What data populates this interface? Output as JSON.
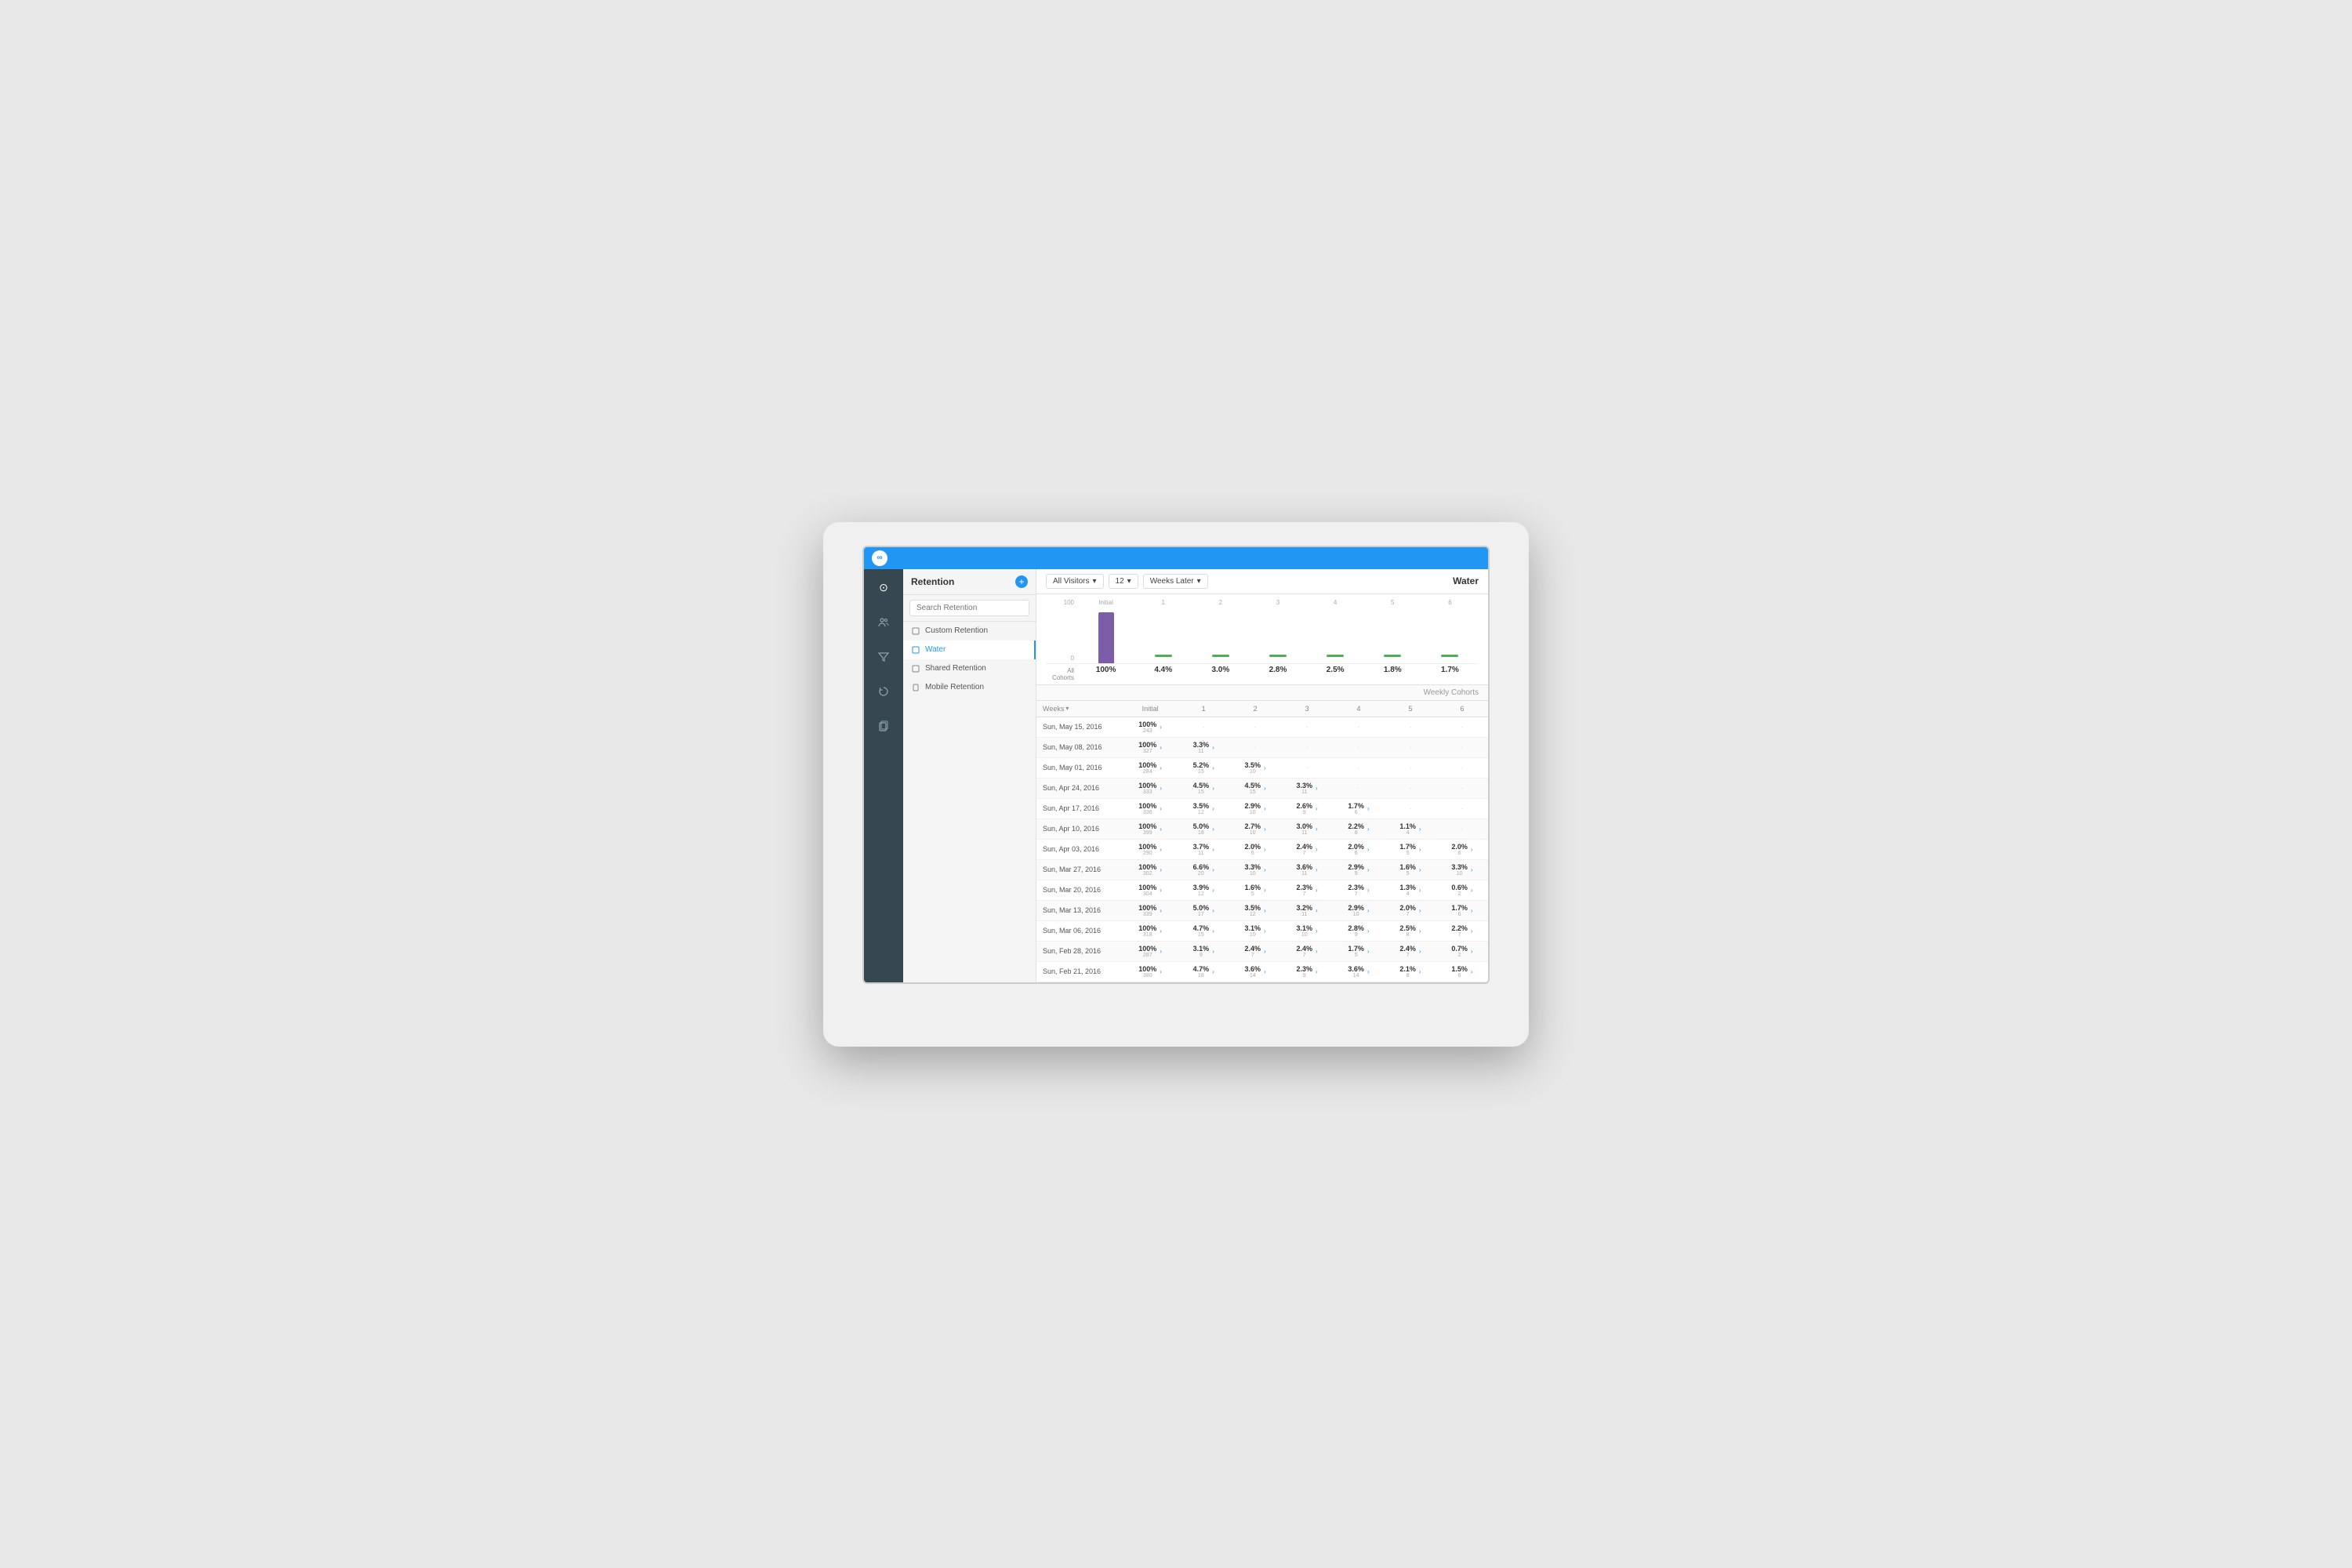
{
  "titleBar": {
    "appIcon": "∞"
  },
  "sidebar": {
    "icons": [
      {
        "name": "clock-icon",
        "symbol": "⊙",
        "active": true
      },
      {
        "name": "users-icon",
        "symbol": "👥",
        "active": false
      },
      {
        "name": "funnel-icon",
        "symbol": "⬡",
        "active": false
      },
      {
        "name": "refresh-icon",
        "symbol": "↺",
        "active": false
      },
      {
        "name": "pages-icon",
        "symbol": "⬜",
        "active": false
      }
    ]
  },
  "leftPanel": {
    "title": "Retention",
    "addBtn": "+",
    "search": {
      "placeholder": "Search Retention"
    },
    "items": [
      {
        "label": "Custom Retention",
        "icon": "□",
        "active": false
      },
      {
        "label": "Water",
        "icon": "□",
        "active": true
      },
      {
        "label": "Shared Retention",
        "icon": "□",
        "active": false
      },
      {
        "label": "Mobile Retention",
        "icon": "□",
        "active": false
      }
    ]
  },
  "toolbar": {
    "allVisitors": "All Visitors",
    "weeks": "12",
    "weeksLater": "Weeks Later",
    "reportTitle": "Water"
  },
  "chart": {
    "yLabels": [
      "100",
      "0"
    ],
    "allCohortsLabel": "All Cohorts",
    "columns": [
      {
        "header": "Initial",
        "type": "bar",
        "value": "100%"
      },
      {
        "header": "1",
        "type": "line",
        "value": "4.4%"
      },
      {
        "header": "2",
        "type": "line",
        "value": "3.0%"
      },
      {
        "header": "3",
        "type": "line",
        "value": "2.8%"
      },
      {
        "header": "4",
        "type": "line",
        "value": "2.5%"
      },
      {
        "header": "5",
        "type": "line",
        "value": "1.8%"
      },
      {
        "header": "6",
        "type": "line",
        "value": "1.7%"
      }
    ]
  },
  "table": {
    "weeklyCohorts": "Weekly Cohorts",
    "headers": [
      "Weeks",
      "Initial",
      "1",
      "2",
      "3",
      "4",
      "5",
      "6"
    ],
    "rows": [
      {
        "date": "Sun, May 15, 2016",
        "cells": [
          {
            "pct": "100%",
            "count": "243",
            "arrow": true
          },
          {
            "pct": "",
            "count": "",
            "dot": true
          },
          {
            "pct": "",
            "count": "",
            "dot": true
          },
          {
            "pct": "",
            "count": "",
            "dot": true
          },
          {
            "pct": "",
            "count": "",
            "dot": true
          },
          {
            "pct": "",
            "count": "",
            "dot": true
          },
          {
            "pct": "",
            "count": "",
            "dot": true
          }
        ]
      },
      {
        "date": "Sun, May 08, 2016",
        "cells": [
          {
            "pct": "100%",
            "count": "327",
            "arrow": true
          },
          {
            "pct": "3.3%",
            "count": "11",
            "arrow": true
          },
          {
            "pct": "",
            "count": "",
            "dot": true
          },
          {
            "pct": "",
            "count": "",
            "dot": true
          },
          {
            "pct": "",
            "count": "",
            "dot": true
          },
          {
            "pct": "",
            "count": "",
            "dot": true
          },
          {
            "pct": "",
            "count": "",
            "dot": true
          }
        ]
      },
      {
        "date": "Sun, May 01, 2016",
        "cells": [
          {
            "pct": "100%",
            "count": "284",
            "arrow": true
          },
          {
            "pct": "5.2%",
            "count": "15",
            "arrow": true
          },
          {
            "pct": "3.5%",
            "count": "10",
            "arrow": true
          },
          {
            "pct": "",
            "count": "",
            "dot": true
          },
          {
            "pct": "",
            "count": "",
            "dot": true
          },
          {
            "pct": "",
            "count": "",
            "dot": true
          },
          {
            "pct": "",
            "count": "",
            "dot": true
          }
        ]
      },
      {
        "date": "Sun, Apr 24, 2016",
        "cells": [
          {
            "pct": "100%",
            "count": "333",
            "arrow": true
          },
          {
            "pct": "4.5%",
            "count": "15",
            "arrow": true
          },
          {
            "pct": "4.5%",
            "count": "15",
            "arrow": true
          },
          {
            "pct": "3.3%",
            "count": "11",
            "arrow": true
          },
          {
            "pct": "",
            "count": "",
            "dot": true
          },
          {
            "pct": "",
            "count": "",
            "dot": true
          },
          {
            "pct": "",
            "count": "",
            "dot": true
          }
        ]
      },
      {
        "date": "Sun, Apr 17, 2016",
        "cells": [
          {
            "pct": "100%",
            "count": "336",
            "arrow": true
          },
          {
            "pct": "3.5%",
            "count": "12",
            "arrow": true
          },
          {
            "pct": "2.9%",
            "count": "10",
            "arrow": true
          },
          {
            "pct": "2.6%",
            "count": "9",
            "arrow": true
          },
          {
            "pct": "1.7%",
            "count": "6",
            "arrow": true
          },
          {
            "pct": "",
            "count": "",
            "dot": true
          },
          {
            "pct": "",
            "count": "",
            "dot": true
          }
        ]
      },
      {
        "date": "Sun, Apr 10, 2016",
        "cells": [
          {
            "pct": "100%",
            "count": "399",
            "arrow": true
          },
          {
            "pct": "5.0%",
            "count": "18",
            "arrow": true
          },
          {
            "pct": "2.7%",
            "count": "10",
            "arrow": true
          },
          {
            "pct": "3.0%",
            "count": "11",
            "arrow": true
          },
          {
            "pct": "2.2%",
            "count": "8",
            "arrow": true
          },
          {
            "pct": "1.1%",
            "count": "4",
            "arrow": true
          },
          {
            "pct": "",
            "count": "",
            "dot": true
          }
        ]
      },
      {
        "date": "Sun, Apr 03, 2016",
        "cells": [
          {
            "pct": "100%",
            "count": "290",
            "arrow": true
          },
          {
            "pct": "3.7%",
            "count": "11",
            "arrow": true
          },
          {
            "pct": "2.0%",
            "count": "6",
            "arrow": true
          },
          {
            "pct": "2.4%",
            "count": "7",
            "arrow": true
          },
          {
            "pct": "2.0%",
            "count": "6",
            "arrow": true
          },
          {
            "pct": "1.7%",
            "count": "5",
            "arrow": true
          },
          {
            "pct": "2.0%",
            "count": "6",
            "arrow": true
          }
        ]
      },
      {
        "date": "Sun, Mar 27, 2016",
        "cells": [
          {
            "pct": "100%",
            "count": "302",
            "arrow": true
          },
          {
            "pct": "6.6%",
            "count": "20",
            "arrow": true
          },
          {
            "pct": "3.3%",
            "count": "10",
            "arrow": true
          },
          {
            "pct": "3.6%",
            "count": "11",
            "arrow": true
          },
          {
            "pct": "2.9%",
            "count": "9",
            "arrow": true
          },
          {
            "pct": "1.6%",
            "count": "5",
            "arrow": true
          },
          {
            "pct": "3.3%",
            "count": "10",
            "arrow": true
          }
        ]
      },
      {
        "date": "Sun, Mar 20, 2016",
        "cells": [
          {
            "pct": "100%",
            "count": "304",
            "arrow": true
          },
          {
            "pct": "3.9%",
            "count": "12",
            "arrow": true
          },
          {
            "pct": "1.6%",
            "count": "5",
            "arrow": true
          },
          {
            "pct": "2.3%",
            "count": "7",
            "arrow": true
          },
          {
            "pct": "2.3%",
            "count": "7",
            "arrow": true
          },
          {
            "pct": "1.3%",
            "count": "4",
            "arrow": true
          },
          {
            "pct": "0.6%",
            "count": "2",
            "arrow": true
          }
        ]
      },
      {
        "date": "Sun, Mar 13, 2016",
        "cells": [
          {
            "pct": "100%",
            "count": "339",
            "arrow": true
          },
          {
            "pct": "5.0%",
            "count": "17",
            "arrow": true
          },
          {
            "pct": "3.5%",
            "count": "12",
            "arrow": true
          },
          {
            "pct": "3.2%",
            "count": "11",
            "arrow": true
          },
          {
            "pct": "2.9%",
            "count": "10",
            "arrow": true
          },
          {
            "pct": "2.0%",
            "count": "7",
            "arrow": true
          },
          {
            "pct": "1.7%",
            "count": "6",
            "arrow": true
          }
        ]
      },
      {
        "date": "Sun, Mar 06, 2016",
        "cells": [
          {
            "pct": "100%",
            "count": "318",
            "arrow": true
          },
          {
            "pct": "4.7%",
            "count": "15",
            "arrow": true
          },
          {
            "pct": "3.1%",
            "count": "10",
            "arrow": true
          },
          {
            "pct": "3.1%",
            "count": "10",
            "arrow": true
          },
          {
            "pct": "2.8%",
            "count": "9",
            "arrow": true
          },
          {
            "pct": "2.5%",
            "count": "8",
            "arrow": true
          },
          {
            "pct": "2.2%",
            "count": "7",
            "arrow": true
          }
        ]
      },
      {
        "date": "Sun, Feb 28, 2016",
        "cells": [
          {
            "pct": "100%",
            "count": "287",
            "arrow": true
          },
          {
            "pct": "3.1%",
            "count": "9",
            "arrow": true
          },
          {
            "pct": "2.4%",
            "count": "7",
            "arrow": true
          },
          {
            "pct": "2.4%",
            "count": "7",
            "arrow": true
          },
          {
            "pct": "1.7%",
            "count": "5",
            "arrow": true
          },
          {
            "pct": "2.4%",
            "count": "7",
            "arrow": true
          },
          {
            "pct": "0.7%",
            "count": "2",
            "arrow": true
          }
        ]
      },
      {
        "date": "Sun, Feb 21, 2016",
        "cells": [
          {
            "pct": "100%",
            "count": "380",
            "arrow": true
          },
          {
            "pct": "4.7%",
            "count": "18",
            "arrow": true
          },
          {
            "pct": "3.6%",
            "count": "14",
            "arrow": true
          },
          {
            "pct": "2.3%",
            "count": "9",
            "arrow": true
          },
          {
            "pct": "3.6%",
            "count": "14",
            "arrow": true
          },
          {
            "pct": "2.1%",
            "count": "8",
            "arrow": true
          },
          {
            "pct": "1.5%",
            "count": "6",
            "arrow": true
          }
        ]
      }
    ]
  }
}
